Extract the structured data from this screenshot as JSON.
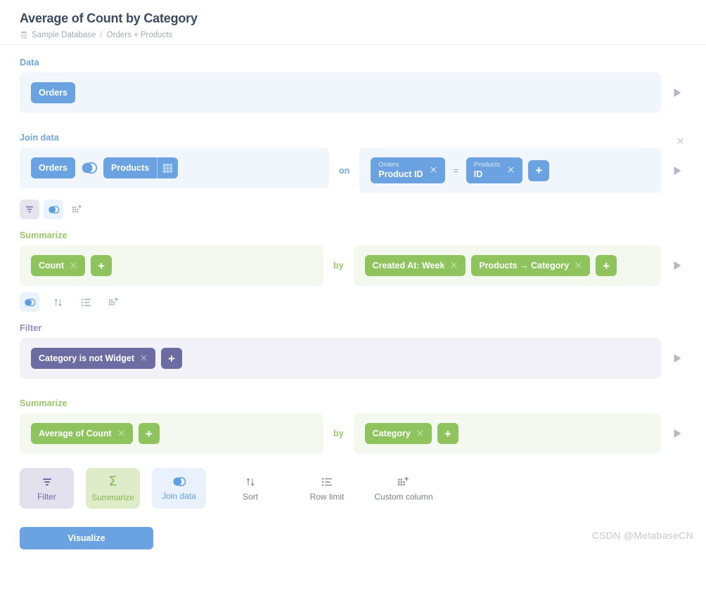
{
  "header": {
    "title": "Average of Count by Category",
    "breadcrumb": {
      "db_icon": "database-icon",
      "database": "Sample Database",
      "separator": "/",
      "source": "Orders + Products"
    }
  },
  "steps": {
    "data": {
      "label": "Data",
      "table": "Orders",
      "preview_icon": "play-triangle-icon"
    },
    "join": {
      "label": "Join data",
      "close_icon": "close-icon",
      "left_table": "Orders",
      "right_table": "Products",
      "join_type_icon": "venn-left-join-icon",
      "fields_icon": "grid-icon",
      "on_word": "on",
      "equals": "=",
      "left_condition": {
        "table": "Orders",
        "field": "Product ID",
        "remove_icon": "close-icon"
      },
      "right_condition": {
        "table": "Products",
        "field": "ID",
        "remove_icon": "close-icon"
      },
      "add_label": "+",
      "preview_icon": "play-triangle-icon"
    },
    "join_actions": [
      {
        "name": "filter",
        "icon": "filter-funnel-icon",
        "style": "purple"
      },
      {
        "name": "join-data",
        "icon": "venn-join-icon",
        "style": "blue"
      },
      {
        "name": "custom-column",
        "icon": "custom-column-icon",
        "style": "plain"
      }
    ],
    "summarize_1": {
      "label": "Summarize",
      "metrics": [
        {
          "label": "Count",
          "remove_icon": "close-icon"
        }
      ],
      "metric_add_label": "+",
      "by_word": "by",
      "breakouts": [
        {
          "label": "Created At: Week",
          "remove_icon": "close-icon"
        },
        {
          "label": "Products → Category",
          "remove_icon": "close-icon"
        }
      ],
      "breakout_add_label": "+",
      "preview_icon": "play-triangle-icon"
    },
    "summarize_1_actions": [
      {
        "name": "join-data",
        "icon": "venn-join-icon",
        "style": "blue"
      },
      {
        "name": "sort",
        "icon": "sort-arrows-icon",
        "style": "plain"
      },
      {
        "name": "row-limit",
        "icon": "row-limit-list-icon",
        "style": "plain"
      },
      {
        "name": "custom-column",
        "icon": "custom-column-icon",
        "style": "plain"
      }
    ],
    "filter": {
      "label": "Filter",
      "clauses": [
        {
          "label": "Category is not Widget",
          "remove_icon": "close-icon"
        }
      ],
      "add_label": "+",
      "preview_icon": "play-triangle-icon"
    },
    "summarize_2": {
      "label": "Summarize",
      "metrics": [
        {
          "label": "Average of Count",
          "remove_icon": "close-icon"
        }
      ],
      "metric_add_label": "+",
      "by_word": "by",
      "breakouts": [
        {
          "label": "Category",
          "remove_icon": "close-icon"
        }
      ],
      "breakout_add_label": "+",
      "preview_icon": "play-triangle-icon"
    }
  },
  "bottom_actions": [
    {
      "label": "Filter",
      "icon": "filter-funnel-icon",
      "style": "filter"
    },
    {
      "label": "Summarize",
      "icon": "sigma-icon",
      "style": "summarize"
    },
    {
      "label": "Join data",
      "icon": "venn-join-icon",
      "style": "join"
    },
    {
      "label": "Sort",
      "icon": "sort-arrows-icon",
      "style": "plain"
    },
    {
      "label": "Row limit",
      "icon": "row-limit-list-icon",
      "style": "plain"
    },
    {
      "label": "Custom column",
      "icon": "custom-column-icon",
      "style": "plain"
    }
  ],
  "visualize": {
    "label": "Visualize"
  },
  "watermark": "CSDN @MetabaseCN",
  "colors": {
    "blue": "#6ba3e2",
    "green": "#8ec35d",
    "purple": "#6c6ca3",
    "title": "#3b4a5f",
    "panel_blue": "#f0f6fc",
    "panel_green": "#f4f8ee",
    "panel_purple": "#f1f1f7"
  }
}
